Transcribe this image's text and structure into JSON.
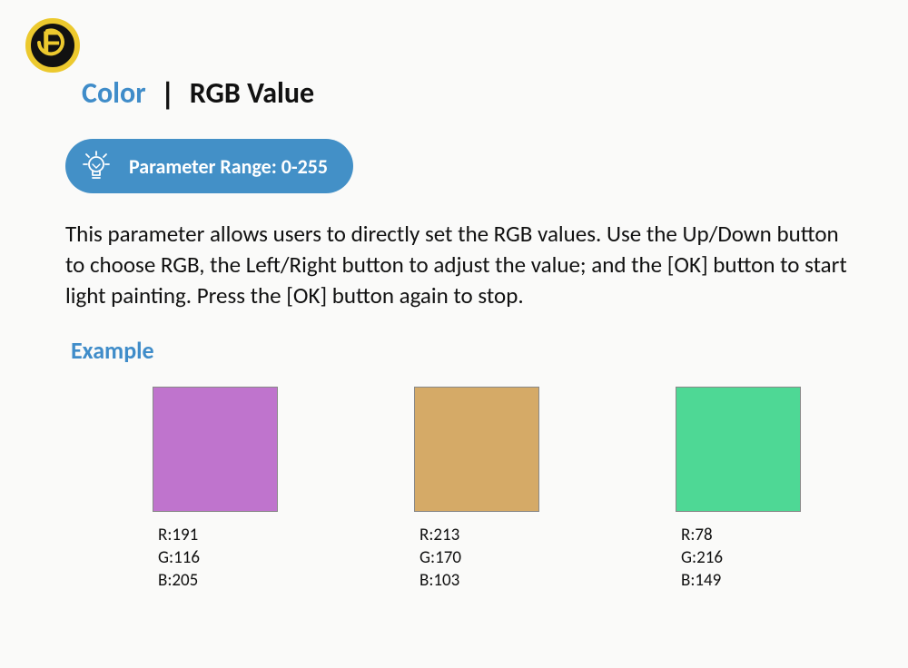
{
  "title": {
    "accent": "Color",
    "separator": "|",
    "main": "RGB Value"
  },
  "parameter_range_label": "Parameter Range: 0-255",
  "body_text": "This parameter allows users to directly set the RGB values. Use the Up/Down button to choose RGB, the Left/Right button to adjust the value; and the [OK] button to start light painting. Press the [OK] button again to stop.",
  "example_label": "Example",
  "swatches": [
    {
      "r": 191,
      "g": 116,
      "b": 205,
      "hex": "#bf74cd",
      "r_label": "R:191",
      "g_label": "G:116",
      "b_label": "B:205"
    },
    {
      "r": 213,
      "g": 170,
      "b": 103,
      "hex": "#d5aa67",
      "r_label": "R:213",
      "g_label": "G:170",
      "b_label": "B:103"
    },
    {
      "r": 78,
      "g": 216,
      "b": 149,
      "hex": "#4ed895",
      "r_label": "R:78",
      "g_label": "G:216",
      "b_label": "B:149"
    }
  ]
}
